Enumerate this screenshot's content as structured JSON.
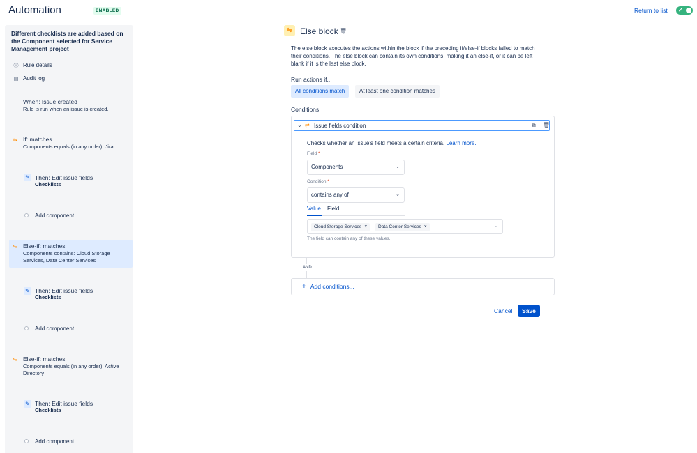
{
  "header": {
    "title": "Automation",
    "status_badge": "ENABLED",
    "return_link": "Return to list",
    "toggle_state": "on",
    "toggle_check": "✓"
  },
  "sidebar": {
    "rule_title": "Different checklists are added based on the Component selected for Service Management project",
    "links": [
      {
        "label": "Rule details",
        "icon": "info-icon"
      },
      {
        "label": "Audit log",
        "icon": "document-icon"
      }
    ],
    "trigger": {
      "title": "When: Issue created",
      "desc": "Rule is run when an issue is created."
    },
    "blocks": [
      {
        "title": "If: matches",
        "desc": "Components equals (in any order): Jira",
        "action_title": "Then: Edit issue fields",
        "action_sub": "Checklists",
        "add": "Add component"
      },
      {
        "title": "Else-if: matches",
        "desc": "Components contains: Cloud Storage Services, Data Center Services",
        "action_title": "Then: Edit issue fields",
        "action_sub": "Checklists",
        "add": "Add component",
        "selected": true
      },
      {
        "title": "Else-if: matches",
        "desc": "Components equals (in any order): Active Directory",
        "action_title": "Then: Edit issue fields",
        "action_sub": "Checklists",
        "add": "Add component"
      }
    ]
  },
  "main": {
    "title": "Else block",
    "description": "The else block executes the actions within the block if the preceding if/else-if blocks failed to match their conditions. The else block can contain its own conditions, making it an else-if, or it can be left blank if it is the last else block.",
    "run_actions_label": "Run actions if...",
    "run_options": [
      "All conditions match",
      "At least one condition matches"
    ],
    "run_selected": "All conditions match",
    "conditions_label": "Conditions",
    "condition": {
      "title": "Issue fields condition",
      "checks_text": "Checks whether an issue's field meets a certain criteria.",
      "learn_more": "Learn more.",
      "field_label": "Field",
      "field_value": "Components",
      "condition_label": "Condition",
      "condition_value": "contains any of",
      "tabs": [
        "Value",
        "Field"
      ],
      "active_tab": "Value",
      "values": [
        "Cloud Storage Services",
        "Data Center Services"
      ],
      "help": "The field can contain any of these values."
    },
    "and_label": "AND",
    "add_conditions": "Add conditions...",
    "cancel": "Cancel",
    "save": "Save"
  },
  "colors": {
    "brand": "#0052cc",
    "toggle": "#36b37e",
    "selected_bg": "#deebff",
    "block_icon": "#ff8b00"
  }
}
